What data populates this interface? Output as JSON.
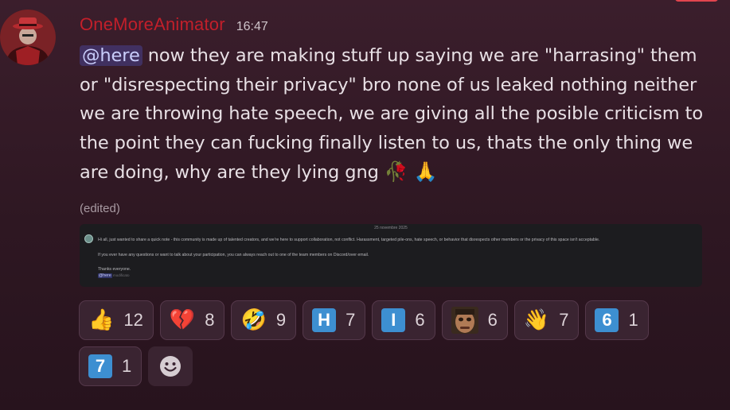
{
  "message": {
    "username": "OneMoreAnimator",
    "timestamp": "16:47",
    "mention": "@here",
    "text": " now they are making stuff up saying we are \"harrasing\" them or \"disrespecting their privacy\" bro none of us leaked nothing neither we are throwing hate speech, we are giving all the posible criticism to the point they can fucking finally listen to us, thats the only thing we are doing, why are they lying gng ",
    "trailing_emojis": [
      "wilted-flower",
      "folded-hands"
    ],
    "edited_label": "(edited)",
    "username_color": "#c21f2a"
  },
  "attachment": {
    "date": "25 novembre 2025",
    "line1": "Hi all, just wanted to share a quick note - this community is made up of talented creators, and we're here to support collaboration, not conflict. Harassment, targeted pile-ons, hate speech, or behavior that disrespects other members or the privacy of this space isn't acceptable.",
    "line2": "If you ever have any questions or want to talk about your participation, you can always reach out to one of the team members on Discord/over email.",
    "line3": "Thanks everyone.",
    "mention": "@here",
    "time": "modificato"
  },
  "reactions": [
    {
      "name": "thumbs-up",
      "emoji": "👍",
      "count": "12"
    },
    {
      "name": "broken-heart",
      "emoji": "💔",
      "count": "8"
    },
    {
      "name": "rolling-laughing",
      "emoji": "🤣",
      "count": "9"
    },
    {
      "name": "regional-h",
      "letter": "H",
      "count": "7"
    },
    {
      "name": "regional-i",
      "letter": "I",
      "count": "6"
    },
    {
      "name": "custom-face",
      "image": true,
      "count": "6"
    },
    {
      "name": "waving-hand",
      "emoji": "👋",
      "count": "7"
    },
    {
      "name": "keycap-6",
      "letter": "6",
      "count": "1"
    },
    {
      "name": "keycap-7",
      "letter": "7",
      "count": "1"
    }
  ],
  "add_reaction_icon": "smiley-add-icon"
}
